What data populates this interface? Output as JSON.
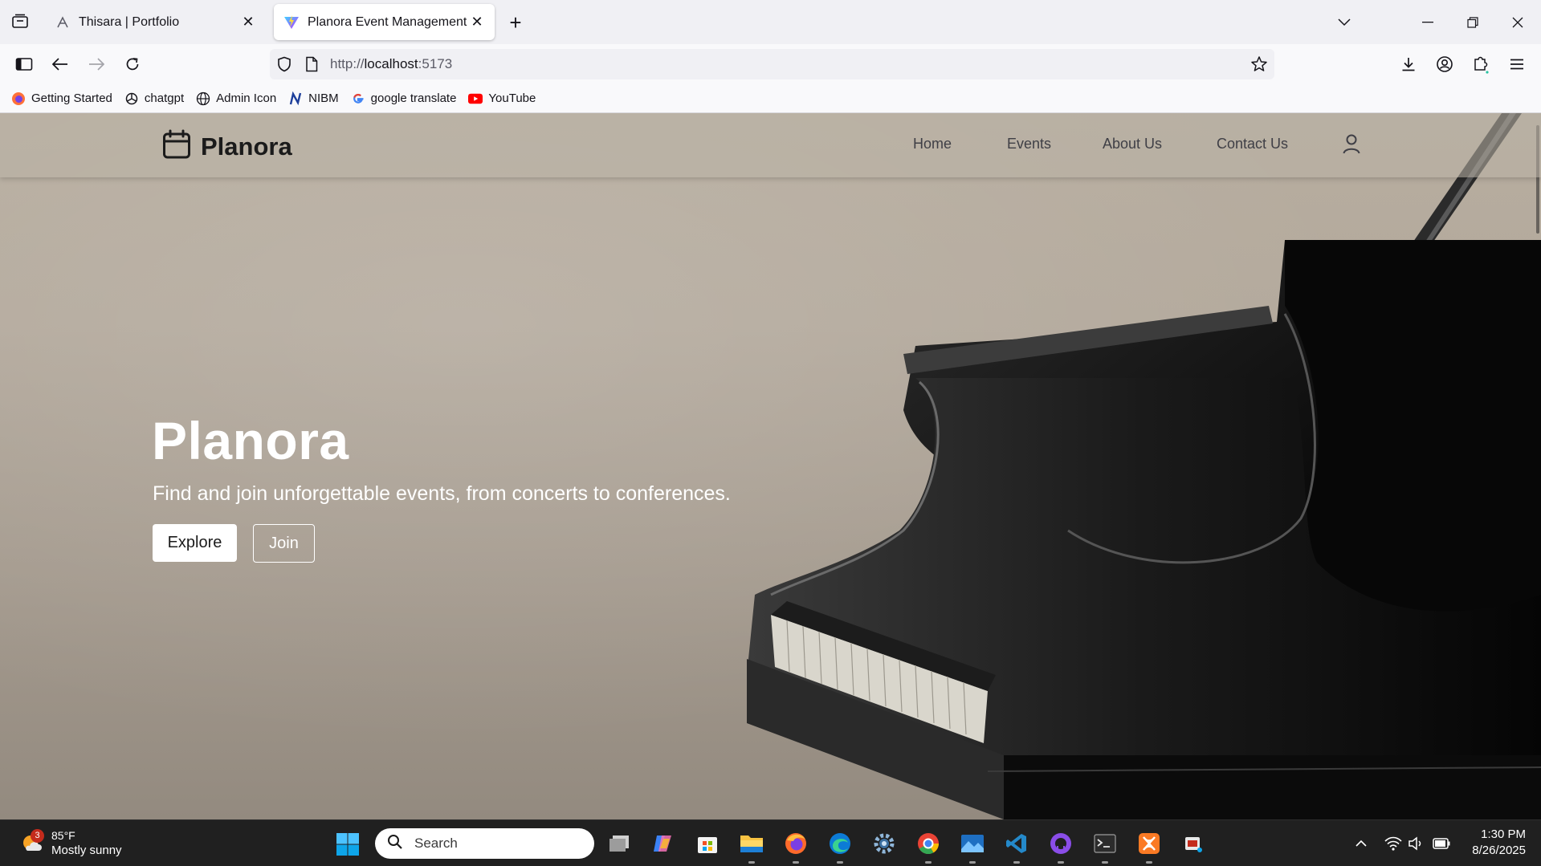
{
  "browser": {
    "tabs": [
      {
        "title": "Thisara | Portfolio",
        "active": false
      },
      {
        "title": "Planora Event Management Platform",
        "active": true
      }
    ],
    "url_prefix": "http://",
    "url_host": "localhost",
    "url_port": ":5173",
    "bookmarks": [
      {
        "label": "Getting Started",
        "icon": "firefox-icon"
      },
      {
        "label": "chatgpt",
        "icon": "chatgpt-icon"
      },
      {
        "label": "Admin Icon",
        "icon": "globe-icon"
      },
      {
        "label": "NIBM",
        "icon": "nibm-icon"
      },
      {
        "label": "google translate",
        "icon": "google-icon"
      },
      {
        "label": "YouTube",
        "icon": "youtube-icon"
      }
    ]
  },
  "site": {
    "brand": "Planora",
    "nav": [
      "Home",
      "Events",
      "About Us",
      "Contact Us"
    ],
    "hero": {
      "title": "Planora",
      "subtitle": "Find and join unforgettable events, from concerts to conferences.",
      "primary_button": "Explore",
      "secondary_button": "Join"
    }
  },
  "taskbar": {
    "weather_badge": "3",
    "temperature": "85°F",
    "condition": "Mostly sunny",
    "search_placeholder": "Search",
    "time": "1:30 PM",
    "date": "8/26/2025"
  },
  "colors": {
    "accent_brand": "#1b1b1b",
    "hero_text": "#ffffff",
    "taskbar_bg": "#202020"
  }
}
